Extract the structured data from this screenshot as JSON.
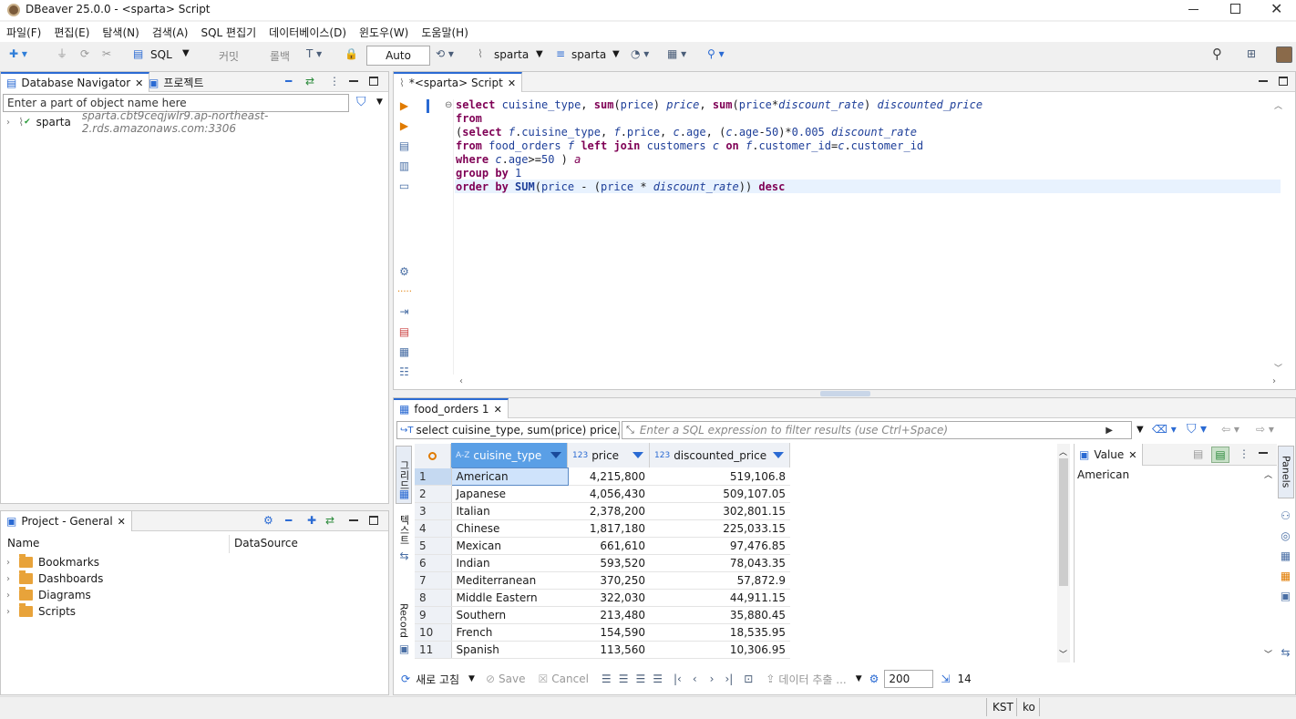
{
  "window": {
    "title": "DBeaver 25.0.0 - <sparta> Script"
  },
  "menu": [
    "파일(F)",
    "편집(E)",
    "탐색(N)",
    "검색(A)",
    "SQL 편집기",
    "데이터베이스(D)",
    "윈도우(W)",
    "도움말(H)"
  ],
  "toolbar": {
    "sql_label": "SQL",
    "commit_label": "커밋",
    "rollback_label": "롤백",
    "tx_mode": "Auto",
    "connection": "sparta",
    "schema": "sparta"
  },
  "navigator": {
    "tab_label": "Database Navigator",
    "projects_tab_label": "프로젝트",
    "filter_placeholder": "Enter a part of object name here",
    "connection_name": "sparta",
    "connection_host": "sparta.cbt9ceqjwlr9.ap-northeast-2.rds.amazonaws.com:3306"
  },
  "project_panel": {
    "tab_label": "Project - General",
    "col_name": "Name",
    "col_datasource": "DataSource",
    "items": [
      "Bookmarks",
      "Dashboards",
      "Diagrams",
      "Scripts"
    ]
  },
  "editor": {
    "tab_label": "*<sparta> Script"
  },
  "results": {
    "tab_label": "food_orders 1",
    "query_preview": "select cuisine_type, sum(price) price, sum",
    "filter_placeholder": "Enter a SQL expression to filter results (use Ctrl+Space)",
    "side_tabs": {
      "grid": "그리드",
      "text": "텍스트",
      "record": "Record"
    },
    "columns": [
      {
        "type": "A-Z",
        "name": "cuisine_type"
      },
      {
        "type": "123",
        "name": "price"
      },
      {
        "type": "123",
        "name": "discounted_price"
      }
    ],
    "rows": [
      {
        "n": "1",
        "cuisine_type": "American",
        "price": "4,215,800",
        "discounted_price": "519,106.8"
      },
      {
        "n": "2",
        "cuisine_type": "Japanese",
        "price": "4,056,430",
        "discounted_price": "509,107.05"
      },
      {
        "n": "3",
        "cuisine_type": "Italian",
        "price": "2,378,200",
        "discounted_price": "302,801.15"
      },
      {
        "n": "4",
        "cuisine_type": "Chinese",
        "price": "1,817,180",
        "discounted_price": "225,033.15"
      },
      {
        "n": "5",
        "cuisine_type": "Mexican",
        "price": "661,610",
        "discounted_price": "97,476.85"
      },
      {
        "n": "6",
        "cuisine_type": "Indian",
        "price": "593,520",
        "discounted_price": "78,043.35"
      },
      {
        "n": "7",
        "cuisine_type": "Mediterranean",
        "price": "370,250",
        "discounted_price": "57,872.9"
      },
      {
        "n": "8",
        "cuisine_type": "Middle Eastern",
        "price": "322,030",
        "discounted_price": "44,911.15"
      },
      {
        "n": "9",
        "cuisine_type": "Southern",
        "price": "213,480",
        "discounted_price": "35,880.45"
      },
      {
        "n": "10",
        "cuisine_type": "French",
        "price": "154,590",
        "discounted_price": "18,535.95"
      },
      {
        "n": "11",
        "cuisine_type": "Spanish",
        "price": "113,560",
        "discounted_price": "10,306.95"
      }
    ],
    "value_panel": {
      "tab_label": "Value",
      "content": "American"
    },
    "panels_label": "Panels",
    "bottom": {
      "refresh": "새로 고침",
      "save": "Save",
      "cancel": "Cancel",
      "export": "데이터 추출 ...",
      "fetch_size": "200",
      "row_count": "14"
    }
  },
  "status": {
    "timezone": "KST",
    "locale": "ko"
  }
}
